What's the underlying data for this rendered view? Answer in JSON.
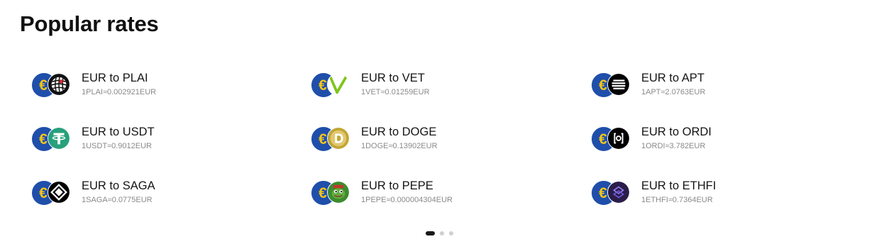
{
  "section": {
    "title": "Popular rates"
  },
  "rates": [
    {
      "label": "EUR to PLAI",
      "value": "1PLAI≈0.002921EUR",
      "icon": "plai-icon"
    },
    {
      "label": "EUR to VET",
      "value": "1VET≈0.01259EUR",
      "icon": "vet-icon"
    },
    {
      "label": "EUR to APT",
      "value": "1APT≈2.0763EUR",
      "icon": "apt-icon"
    },
    {
      "label": "EUR to USDT",
      "value": "1USDT≈0.9012EUR",
      "icon": "usdt-icon"
    },
    {
      "label": "EUR to DOGE",
      "value": "1DOGE≈0.13902EUR",
      "icon": "doge-icon"
    },
    {
      "label": "EUR to ORDI",
      "value": "1ORDI≈3.782EUR",
      "icon": "ordi-icon"
    },
    {
      "label": "EUR to SAGA",
      "value": "1SAGA≈0.0775EUR",
      "icon": "saga-icon"
    },
    {
      "label": "EUR to PEPE",
      "value": "1PEPE≈0.000004304EUR",
      "icon": "pepe-icon"
    },
    {
      "label": "EUR to ETHFI",
      "value": "1ETHFI≈0.7364EUR",
      "icon": "ethfi-icon"
    }
  ],
  "base_currency": {
    "symbol": "€",
    "icon": "euro-icon"
  },
  "pagination": {
    "pages": 3,
    "active": 1
  },
  "colors": {
    "euro_bg": "#1f4faa",
    "euro_symbol": "#f5c518",
    "usdt": "#26a17b",
    "vet": "#7fc41c",
    "doge": "#c2a633",
    "pepe": "#3d8c2f",
    "ethfi": "#2b1d4a"
  }
}
